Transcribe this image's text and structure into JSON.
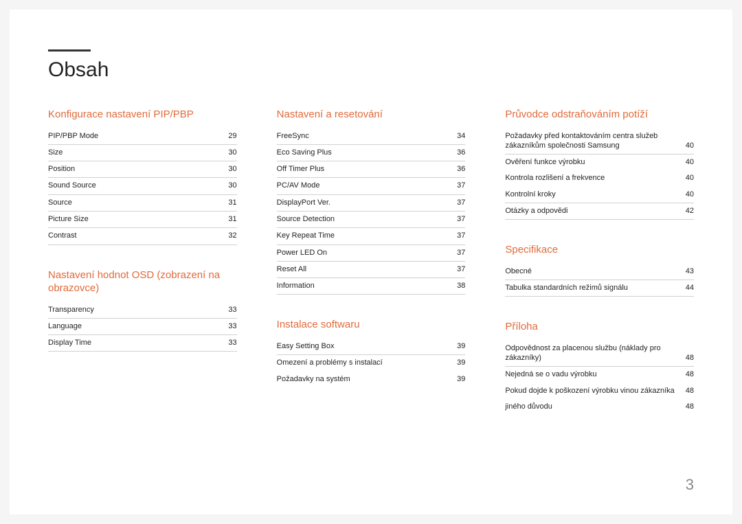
{
  "title": "Obsah",
  "page_number": "3",
  "columns": [
    {
      "sections": [
        {
          "heading": "Konfigurace nastavení PIP/PBP",
          "entries": [
            {
              "label": "PIP/PBP Mode",
              "page": "29",
              "ruled": true
            },
            {
              "label": "Size",
              "page": "30",
              "ruled": true
            },
            {
              "label": "Position",
              "page": "30",
              "ruled": true
            },
            {
              "label": "Sound Source",
              "page": "30",
              "ruled": true
            },
            {
              "label": "Source",
              "page": "31",
              "ruled": true
            },
            {
              "label": "Picture Size",
              "page": "31",
              "ruled": true
            },
            {
              "label": "Contrast",
              "page": "32",
              "ruled": true
            }
          ]
        },
        {
          "heading": "Nastavení hodnot OSD (zobrazení na obrazovce)",
          "entries": [
            {
              "label": "Transparency",
              "page": "33",
              "ruled": true
            },
            {
              "label": "Language",
              "page": "33",
              "ruled": true
            },
            {
              "label": "Display Time",
              "page": "33",
              "ruled": true
            }
          ]
        }
      ]
    },
    {
      "sections": [
        {
          "heading": "Nastavení a resetování",
          "entries": [
            {
              "label": "FreeSync",
              "page": "34",
              "ruled": true
            },
            {
              "label": "Eco Saving Plus",
              "page": "36",
              "ruled": true
            },
            {
              "label": "Off Timer Plus",
              "page": "36",
              "ruled": true
            },
            {
              "label": "PC/AV Mode",
              "page": "37",
              "ruled": true
            },
            {
              "label": "DisplayPort Ver.",
              "page": "37",
              "ruled": true
            },
            {
              "label": "Source Detection",
              "page": "37",
              "ruled": true
            },
            {
              "label": "Key Repeat Time",
              "page": "37",
              "ruled": true
            },
            {
              "label": "Power LED On",
              "page": "37",
              "ruled": true
            },
            {
              "label": "Reset All",
              "page": "37",
              "ruled": true
            },
            {
              "label": "Information",
              "page": "38",
              "ruled": true
            }
          ]
        },
        {
          "heading": "Instalace softwaru",
          "entries": [
            {
              "label": "Easy Setting Box",
              "page": "39",
              "ruled": true
            },
            {
              "label": "Omezení a problémy s instalací",
              "page": "39",
              "ruled": false
            },
            {
              "label": "Požadavky na systém",
              "page": "39",
              "ruled": false
            }
          ]
        }
      ]
    },
    {
      "sections": [
        {
          "heading": "Průvodce odstraňováním potíží",
          "entries": [
            {
              "label": "Požadavky před kontaktováním centra služeb zákazníkům společnosti Samsung",
              "page": "40",
              "ruled": true
            },
            {
              "label": "Ověření funkce výrobku",
              "page": "40",
              "ruled": false
            },
            {
              "label": "Kontrola rozlišení a frekvence",
              "page": "40",
              "ruled": false
            },
            {
              "label": "Kontrolní kroky",
              "page": "40",
              "ruled": true
            },
            {
              "label": "Otázky a odpovědi",
              "page": "42",
              "ruled": true
            }
          ]
        },
        {
          "heading": "Specifikace",
          "entries": [
            {
              "label": "Obecné",
              "page": "43",
              "ruled": true
            },
            {
              "label": "Tabulka standardních režimů signálu",
              "page": "44",
              "ruled": true
            }
          ]
        },
        {
          "heading": "Příloha",
          "entries": [
            {
              "label": "Odpovědnost za placenou službu (náklady pro zákazníky)",
              "page": "48",
              "ruled": true
            },
            {
              "label": "Nejedná se o vadu výrobku",
              "page": "48",
              "ruled": false
            },
            {
              "label": "Pokud dojde k poškození výrobku vinou zákazníka",
              "page": "48",
              "ruled": false
            },
            {
              "label": "jiného důvodu",
              "page": "48",
              "ruled": false
            }
          ]
        }
      ]
    }
  ]
}
